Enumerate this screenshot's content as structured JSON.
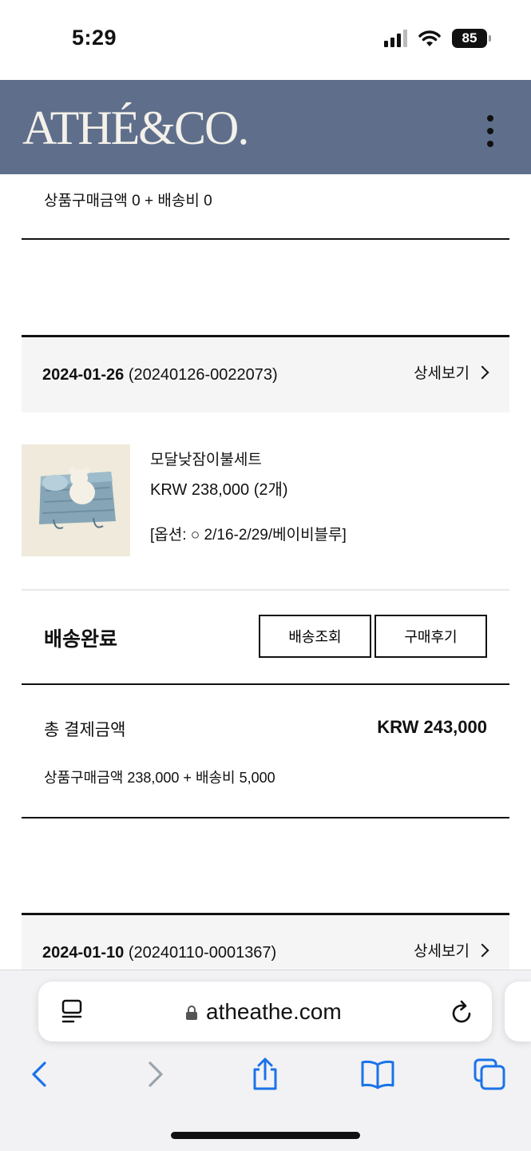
{
  "status_bar": {
    "time": "5:29",
    "battery": "85"
  },
  "header": {
    "brand": "ATHÉ&CO."
  },
  "prev_order": {
    "summary": "상품구매금액 0 + 배송비 0"
  },
  "order": {
    "date": "2024-01-26",
    "number": "(20240126-0022073)",
    "detail_label": "상세보기",
    "product": {
      "name": "모달낮잠이불세트",
      "price": "KRW 238,000 (2개)",
      "option": "[옵션: ○ 2/16-2/29/베이비블루]"
    },
    "status": "배송완료",
    "buttons": {
      "tracking": "배송조회",
      "review": "구매후기"
    },
    "total_label": "총 결제금액",
    "total_value": "KRW 243,000",
    "breakdown": "상품구매금액 238,000 + 배송비 5,000"
  },
  "next_order": {
    "date": "2024-01-10",
    "number": "(20240110-0001367)",
    "detail_label": "상세보기"
  },
  "browser": {
    "url": "atheathe.com"
  },
  "colors": {
    "header_bg": "#5f6f8b",
    "brand_text": "#f4f1ea",
    "ios_blue": "#1a73e8"
  }
}
